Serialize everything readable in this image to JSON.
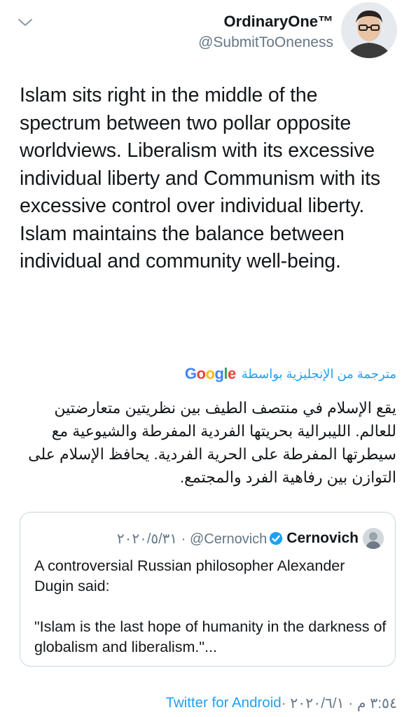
{
  "header": {
    "display_name": "OrdinaryOne™",
    "handle": "@SubmitToOneness",
    "menu_icon": "chevron-down-icon",
    "avatar_icon": "avatar"
  },
  "tweet": {
    "text": "Islam sits right in the middle of the spectrum between two pollar opposite worldviews. Liberalism with its excessive individual liberty and Communism with its excessive control over individual liberty. Islam maintains the balance between individual and community well-being."
  },
  "translation": {
    "label": "مترجمة من الإنجليزية بواسطة",
    "provider": "Google",
    "text": "يقع الإسلام في منتصف الطيف بين نظريتين متعارضتين للعالم. الليبرالية بحريتها الفردية المفرطة والشيوعية مع سيطرتها المفرطة على الحرية الفردية. يحافظ الإسلام على التوازن بين رفاهية الفرد والمجتمع."
  },
  "quoted_tweet": {
    "display_name": "Cernovich",
    "verified_icon": "verified-badge-icon",
    "meta": "٢٠٢٠/٥/٣١ · @Cernovich",
    "line1": "A controversial Russian philosopher Alexander Dugin said:",
    "line2": "\"Islam is the last hope of humanity in the darkness of globalism and liberalism.\"..."
  },
  "footer": {
    "source": "Twitter for Android",
    "timestamp": " · ٣:٥٤ م · ٢٠٢٠/٦/١"
  },
  "colors": {
    "accent": "#1da1f2",
    "secondary_text": "#657786",
    "border": "#ccd6dd"
  }
}
